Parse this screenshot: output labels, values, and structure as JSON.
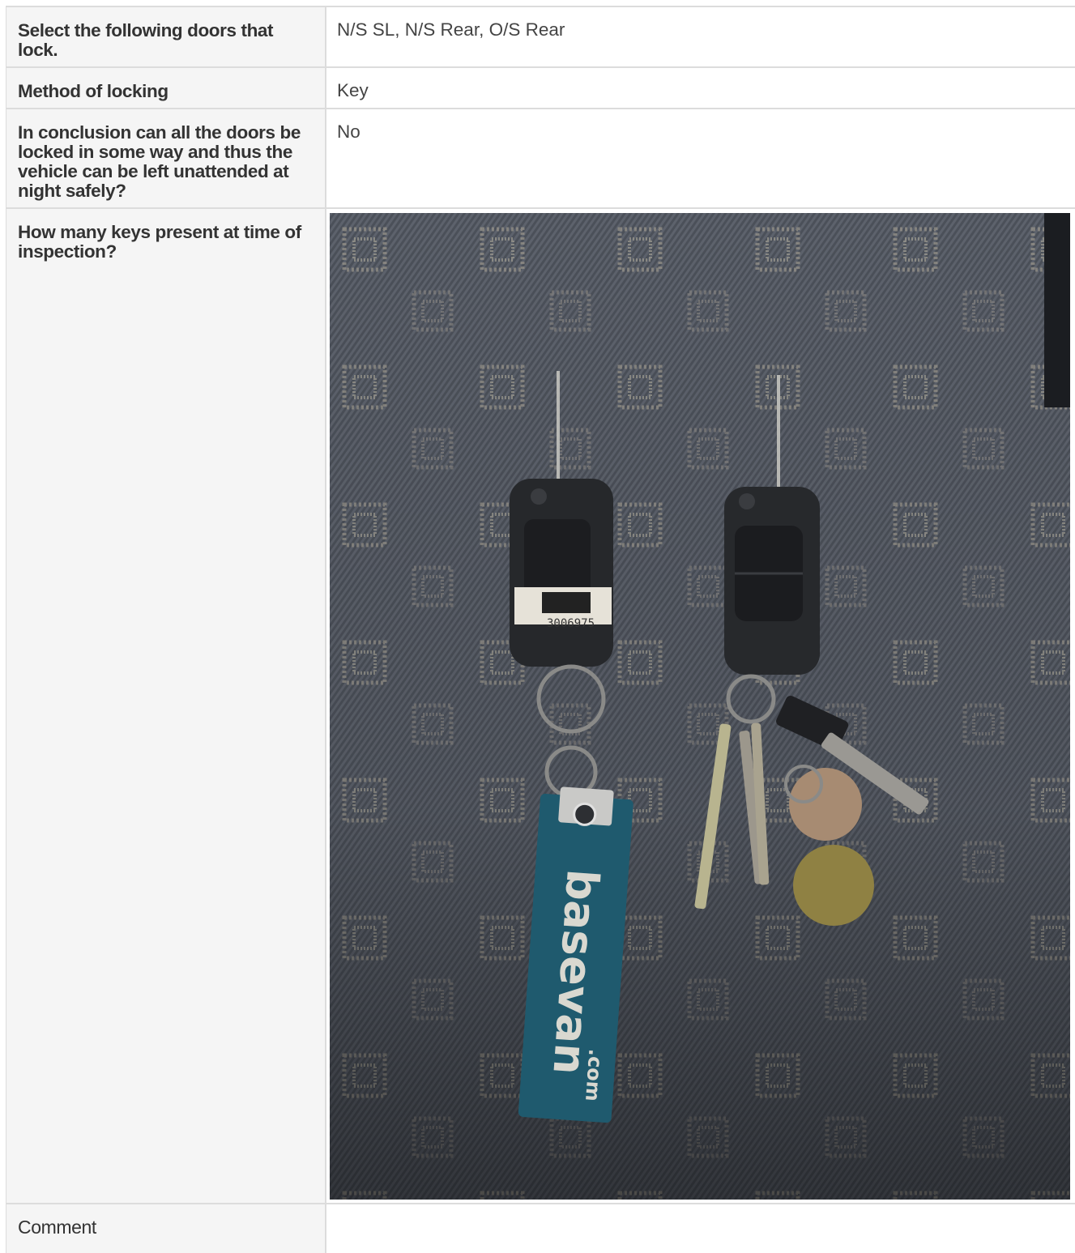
{
  "rows": {
    "doors": {
      "label": "Select the following doors that lock.",
      "value": "N/S SL, N/S Rear, O/S Rear"
    },
    "method": {
      "label": "Method of locking",
      "value": "Key"
    },
    "conclusion": {
      "label": "In conclusion can all the doors be locked in some way and thus the vehicle can be left unattended at night safely?",
      "value": "No"
    },
    "keys": {
      "label": "How many keys present at time of inspection?"
    },
    "comment": {
      "label": "Comment",
      "value": ""
    }
  },
  "photo": {
    "tag_brand": "basevan",
    "tag_suffix": ".com",
    "barcode_number": "3006975"
  },
  "colors": {
    "label_bg": "#f5f5f5",
    "border": "#dcdcdc",
    "fabric": "#4a4f58",
    "tag": "#1f5a6e"
  }
}
